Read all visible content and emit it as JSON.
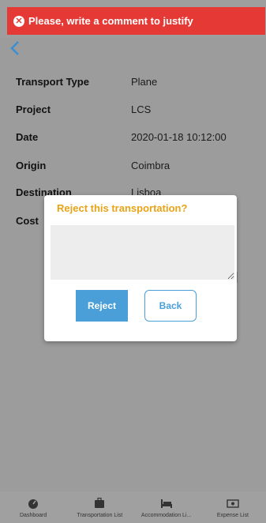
{
  "banner": {
    "message": "Please, write a comment to justify",
    "icon": "close-circle-icon",
    "color": "#e53935"
  },
  "details": [
    {
      "label": "Transport Type",
      "value": "Plane"
    },
    {
      "label": "Project",
      "value": "LCS"
    },
    {
      "label": "Date",
      "value": "2020-01-18 10:12:00"
    },
    {
      "label": "Origin",
      "value": "Coimbra"
    },
    {
      "label": "Destination",
      "value": "Lisboa"
    },
    {
      "label": "Cost",
      "value": ""
    }
  ],
  "dialog": {
    "title": "Reject this transportation?",
    "comment_value": "",
    "reject_label": "Reject",
    "back_label": "Back"
  },
  "nav": [
    {
      "label": "Dashboard",
      "icon": "dashboard-icon"
    },
    {
      "label": "Transportation List",
      "icon": "suitcase-icon"
    },
    {
      "label": "Accommodation Li...",
      "icon": "bed-icon"
    },
    {
      "label": "Expense List",
      "icon": "money-icon"
    }
  ],
  "colors": {
    "accent": "#4a9fd8",
    "title": "#e8a317"
  }
}
